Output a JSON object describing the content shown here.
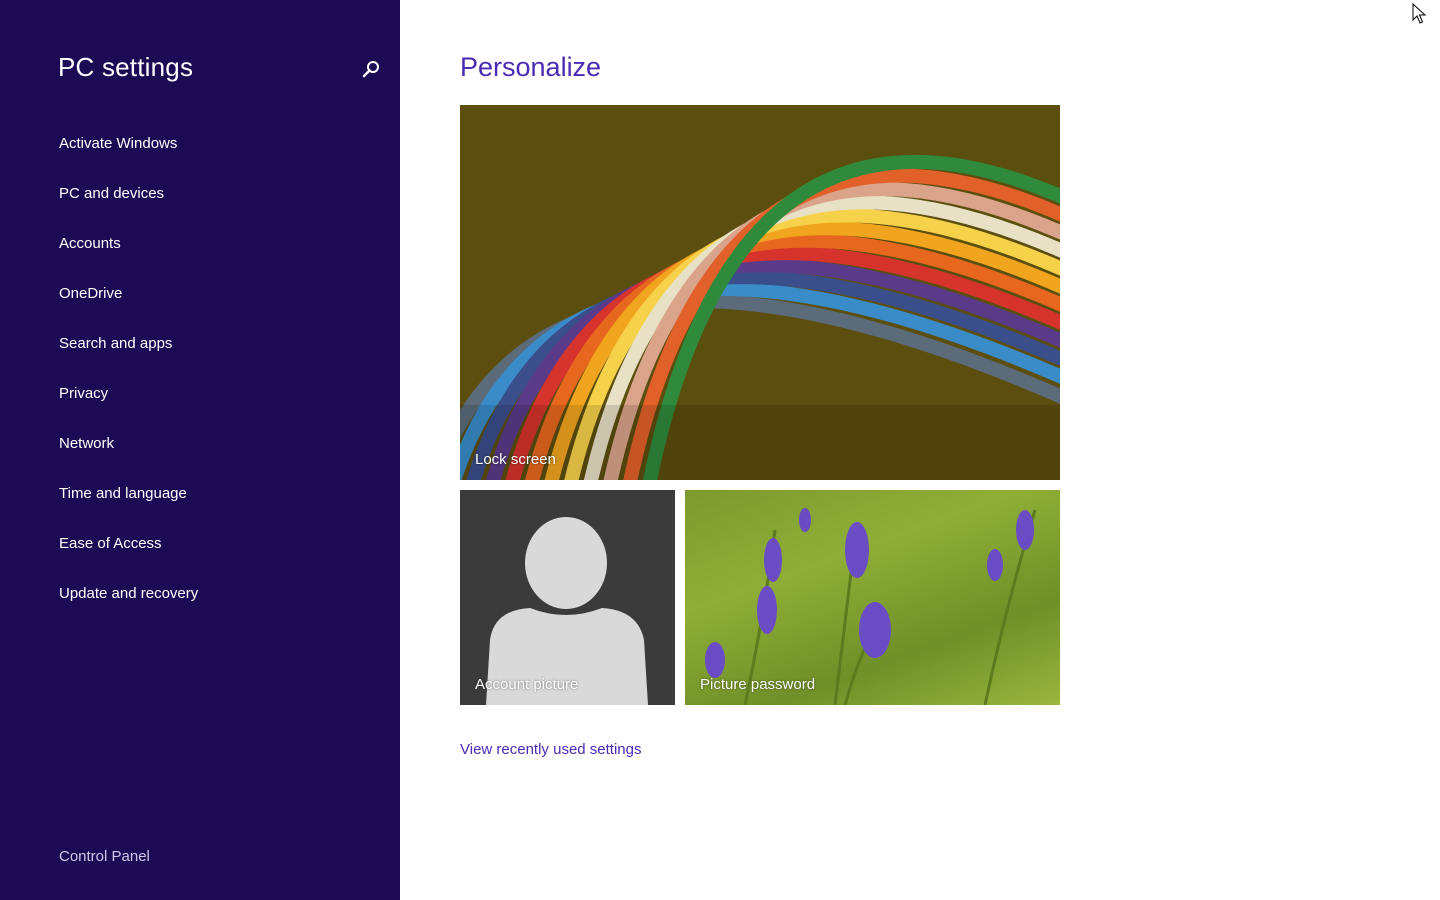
{
  "sidebar": {
    "title": "PC settings",
    "search_icon": "search-icon",
    "items": [
      {
        "label": "Activate Windows"
      },
      {
        "label": "PC and devices"
      },
      {
        "label": "Accounts"
      },
      {
        "label": "OneDrive"
      },
      {
        "label": "Search and apps"
      },
      {
        "label": "Privacy"
      },
      {
        "label": "Network"
      },
      {
        "label": "Time and language"
      },
      {
        "label": "Ease of Access"
      },
      {
        "label": "Update and recovery"
      }
    ],
    "footer_link": "Control Panel"
  },
  "main": {
    "title": "Personalize",
    "tiles": {
      "lock_screen": {
        "label": "Lock screen"
      },
      "account_picture": {
        "label": "Account picture"
      },
      "picture_password": {
        "label": "Picture password"
      }
    },
    "recent_link": "View recently used settings"
  },
  "colors": {
    "sidebar_bg": "#1d0a55",
    "accent": "#4b2bb5",
    "page_bg": "#ffffff"
  }
}
